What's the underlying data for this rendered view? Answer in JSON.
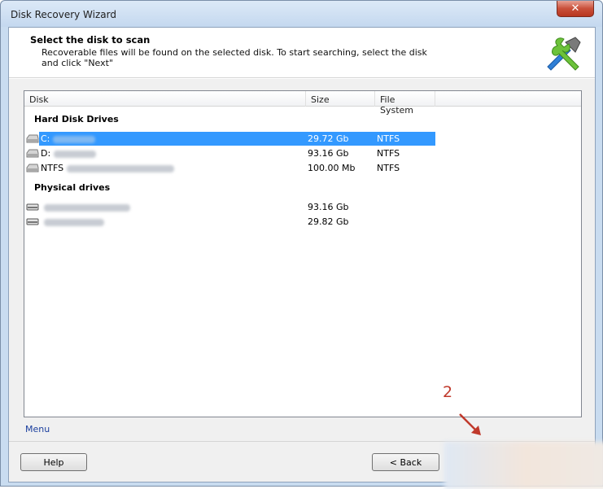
{
  "window": {
    "title": "Disk Recovery Wizard",
    "close_symbol": "✕"
  },
  "header": {
    "title": "Select the disk to scan",
    "description": "Recoverable files will be found on the selected disk. To start searching, select the disk and click \"Next\""
  },
  "columns": {
    "disk": "Disk",
    "size": "Size",
    "file_system": "File System"
  },
  "groups": {
    "hard_disk_drives": {
      "label": "Hard Disk Drives",
      "rows": [
        {
          "name": "C:",
          "size": "29.72 Gb",
          "fs": "NTFS",
          "selected": true
        },
        {
          "name": "D:",
          "size": "93.16 Gb",
          "fs": "NTFS",
          "selected": false
        },
        {
          "name": "NTFS",
          "size": "100.00 Mb",
          "fs": "NTFS",
          "selected": false
        }
      ]
    },
    "physical_drives": {
      "label": "Physical drives",
      "rows": [
        {
          "name": "",
          "size": "93.16 Gb",
          "fs": ""
        },
        {
          "name": "",
          "size": "29.82 Gb",
          "fs": ""
        }
      ]
    }
  },
  "menu_label": "Menu",
  "buttons": {
    "help": "Help",
    "back": "< Back"
  },
  "annotation": {
    "number": "2"
  },
  "colors": {
    "selection": "#3399ff",
    "annotation": "#c0392b",
    "close": "#c9503a"
  }
}
